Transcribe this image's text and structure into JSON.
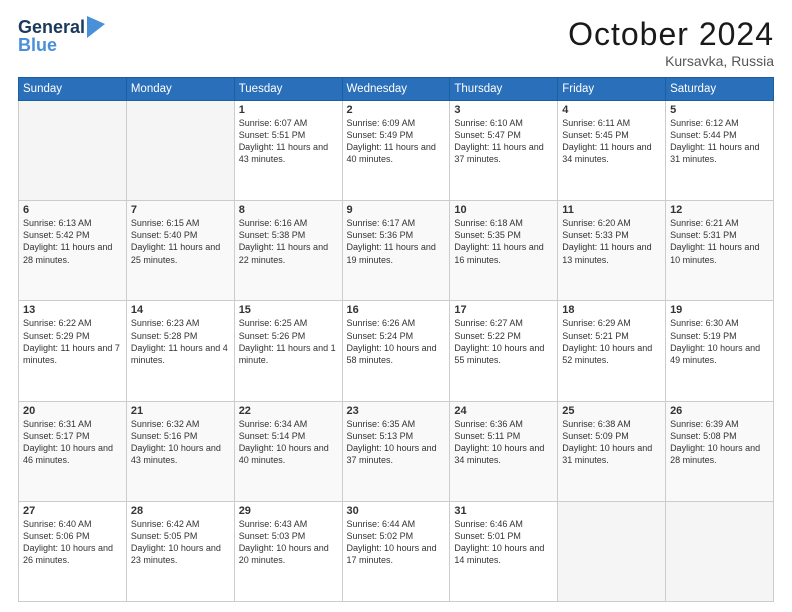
{
  "logo": {
    "line1": "General",
    "line2": "Blue"
  },
  "title": "October 2024",
  "subtitle": "Kursavka, Russia",
  "weekdays": [
    "Sunday",
    "Monday",
    "Tuesday",
    "Wednesday",
    "Thursday",
    "Friday",
    "Saturday"
  ],
  "weeks": [
    [
      {
        "day": "",
        "info": ""
      },
      {
        "day": "",
        "info": ""
      },
      {
        "day": "1",
        "info": "Sunrise: 6:07 AM\nSunset: 5:51 PM\nDaylight: 11 hours and 43 minutes."
      },
      {
        "day": "2",
        "info": "Sunrise: 6:09 AM\nSunset: 5:49 PM\nDaylight: 11 hours and 40 minutes."
      },
      {
        "day": "3",
        "info": "Sunrise: 6:10 AM\nSunset: 5:47 PM\nDaylight: 11 hours and 37 minutes."
      },
      {
        "day": "4",
        "info": "Sunrise: 6:11 AM\nSunset: 5:45 PM\nDaylight: 11 hours and 34 minutes."
      },
      {
        "day": "5",
        "info": "Sunrise: 6:12 AM\nSunset: 5:44 PM\nDaylight: 11 hours and 31 minutes."
      }
    ],
    [
      {
        "day": "6",
        "info": "Sunrise: 6:13 AM\nSunset: 5:42 PM\nDaylight: 11 hours and 28 minutes."
      },
      {
        "day": "7",
        "info": "Sunrise: 6:15 AM\nSunset: 5:40 PM\nDaylight: 11 hours and 25 minutes."
      },
      {
        "day": "8",
        "info": "Sunrise: 6:16 AM\nSunset: 5:38 PM\nDaylight: 11 hours and 22 minutes."
      },
      {
        "day": "9",
        "info": "Sunrise: 6:17 AM\nSunset: 5:36 PM\nDaylight: 11 hours and 19 minutes."
      },
      {
        "day": "10",
        "info": "Sunrise: 6:18 AM\nSunset: 5:35 PM\nDaylight: 11 hours and 16 minutes."
      },
      {
        "day": "11",
        "info": "Sunrise: 6:20 AM\nSunset: 5:33 PM\nDaylight: 11 hours and 13 minutes."
      },
      {
        "day": "12",
        "info": "Sunrise: 6:21 AM\nSunset: 5:31 PM\nDaylight: 11 hours and 10 minutes."
      }
    ],
    [
      {
        "day": "13",
        "info": "Sunrise: 6:22 AM\nSunset: 5:29 PM\nDaylight: 11 hours and 7 minutes."
      },
      {
        "day": "14",
        "info": "Sunrise: 6:23 AM\nSunset: 5:28 PM\nDaylight: 11 hours and 4 minutes."
      },
      {
        "day": "15",
        "info": "Sunrise: 6:25 AM\nSunset: 5:26 PM\nDaylight: 11 hours and 1 minute."
      },
      {
        "day": "16",
        "info": "Sunrise: 6:26 AM\nSunset: 5:24 PM\nDaylight: 10 hours and 58 minutes."
      },
      {
        "day": "17",
        "info": "Sunrise: 6:27 AM\nSunset: 5:22 PM\nDaylight: 10 hours and 55 minutes."
      },
      {
        "day": "18",
        "info": "Sunrise: 6:29 AM\nSunset: 5:21 PM\nDaylight: 10 hours and 52 minutes."
      },
      {
        "day": "19",
        "info": "Sunrise: 6:30 AM\nSunset: 5:19 PM\nDaylight: 10 hours and 49 minutes."
      }
    ],
    [
      {
        "day": "20",
        "info": "Sunrise: 6:31 AM\nSunset: 5:17 PM\nDaylight: 10 hours and 46 minutes."
      },
      {
        "day": "21",
        "info": "Sunrise: 6:32 AM\nSunset: 5:16 PM\nDaylight: 10 hours and 43 minutes."
      },
      {
        "day": "22",
        "info": "Sunrise: 6:34 AM\nSunset: 5:14 PM\nDaylight: 10 hours and 40 minutes."
      },
      {
        "day": "23",
        "info": "Sunrise: 6:35 AM\nSunset: 5:13 PM\nDaylight: 10 hours and 37 minutes."
      },
      {
        "day": "24",
        "info": "Sunrise: 6:36 AM\nSunset: 5:11 PM\nDaylight: 10 hours and 34 minutes."
      },
      {
        "day": "25",
        "info": "Sunrise: 6:38 AM\nSunset: 5:09 PM\nDaylight: 10 hours and 31 minutes."
      },
      {
        "day": "26",
        "info": "Sunrise: 6:39 AM\nSunset: 5:08 PM\nDaylight: 10 hours and 28 minutes."
      }
    ],
    [
      {
        "day": "27",
        "info": "Sunrise: 6:40 AM\nSunset: 5:06 PM\nDaylight: 10 hours and 26 minutes."
      },
      {
        "day": "28",
        "info": "Sunrise: 6:42 AM\nSunset: 5:05 PM\nDaylight: 10 hours and 23 minutes."
      },
      {
        "day": "29",
        "info": "Sunrise: 6:43 AM\nSunset: 5:03 PM\nDaylight: 10 hours and 20 minutes."
      },
      {
        "day": "30",
        "info": "Sunrise: 6:44 AM\nSunset: 5:02 PM\nDaylight: 10 hours and 17 minutes."
      },
      {
        "day": "31",
        "info": "Sunrise: 6:46 AM\nSunset: 5:01 PM\nDaylight: 10 hours and 14 minutes."
      },
      {
        "day": "",
        "info": ""
      },
      {
        "day": "",
        "info": ""
      }
    ]
  ]
}
